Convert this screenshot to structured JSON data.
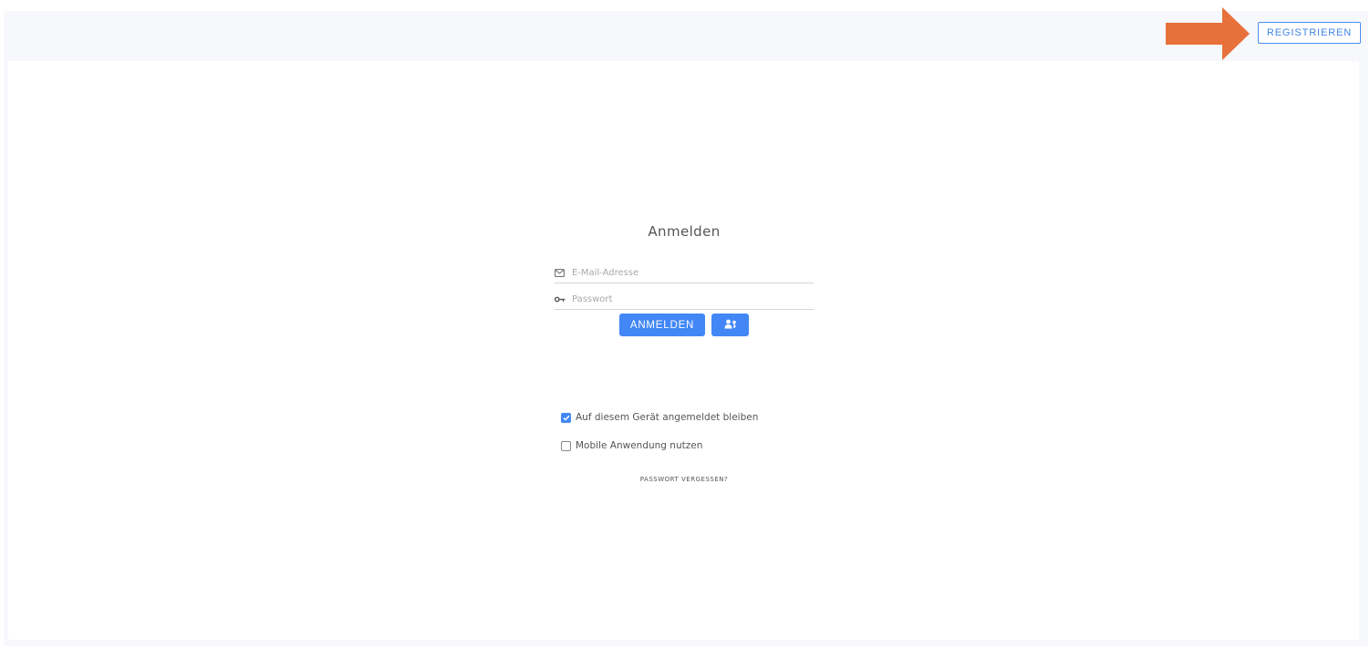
{
  "header": {
    "register_label": "REGISTRIEREN"
  },
  "login": {
    "title": "Anmelden",
    "email_placeholder": "E-Mail-Adresse",
    "password_placeholder": "Passwort",
    "login_label": "ANMELDEN",
    "remember_label": "Auf diesem Gerät angemeldet bleiben",
    "remember_checked": true,
    "mobile_label": "Mobile Anwendung nutzen",
    "mobile_checked": false,
    "forgot_label": "PASSWORT VERGESSEN?"
  },
  "icons": {
    "email": "mail-icon",
    "password": "key-icon",
    "alt_login": "user-key-icon",
    "annotation": "arrow-right-icon"
  },
  "colors": {
    "primary": "#4287f5",
    "annotation_arrow": "#e8703a",
    "frame_bg": "#f7f8fc"
  }
}
